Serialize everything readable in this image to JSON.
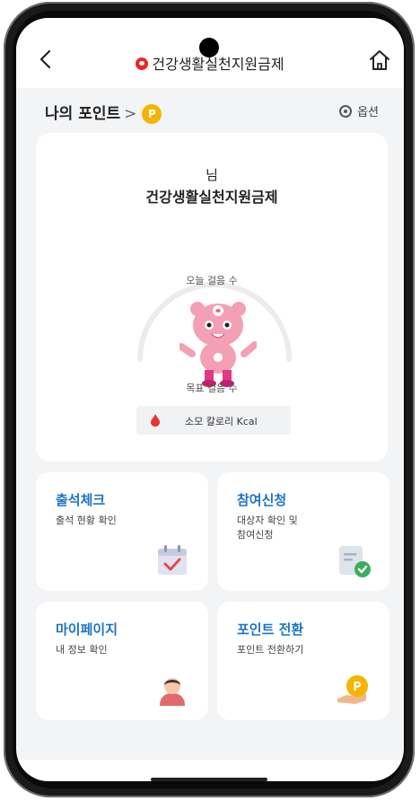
{
  "header": {
    "title": "건강생활실천지원금제",
    "back_icon": "chevron-left-icon",
    "home_icon": "home-icon"
  },
  "points": {
    "label": "나의 포인트",
    "chevron": ">",
    "badge": "P",
    "options_label": "옵션"
  },
  "summary": {
    "name_suffix": "님",
    "program": "건강생활실천지원금제",
    "today_steps_label": "오늘 걸음 수",
    "goal_steps_label": "목표 걸음 수",
    "calorie_label": "소모 칼로리 Kcal"
  },
  "tiles": [
    {
      "title": "출석체크",
      "subtitle": "출석 현황 확인",
      "icon": "calendar-check-icon"
    },
    {
      "title": "참여신청",
      "subtitle": "대상자 확인 및\n참여신청",
      "icon": "document-check-icon"
    },
    {
      "title": "마이페이지",
      "subtitle": "내 정보 확인",
      "icon": "user-avatar-icon"
    },
    {
      "title": "포인트 전환",
      "subtitle": "포인트 전환하기",
      "icon": "point-coin-hand-icon"
    }
  ],
  "colors": {
    "accent_blue": "#1b74c5",
    "brand_red": "#e62727",
    "point_yellow": "#f4b400",
    "background": "#f3f4f6"
  }
}
